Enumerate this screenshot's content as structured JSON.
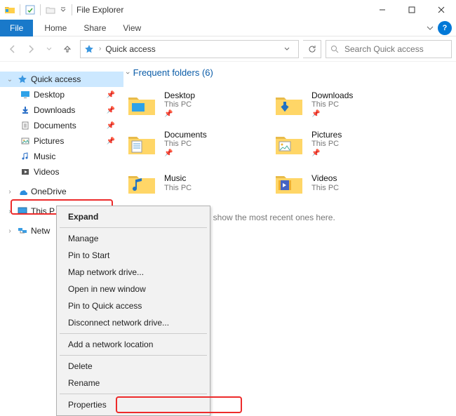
{
  "title": "File Explorer",
  "ribbon": {
    "file": "File",
    "tabs": [
      "Home",
      "Share",
      "View"
    ]
  },
  "address": {
    "text": "Quick access"
  },
  "search": {
    "placeholder": "Search Quick access"
  },
  "tree": {
    "quick_access": {
      "label": "Quick access",
      "children": [
        {
          "label": "Desktop",
          "icon": "desktop",
          "pinned": true
        },
        {
          "label": "Downloads",
          "icon": "downloads",
          "pinned": true
        },
        {
          "label": "Documents",
          "icon": "documents",
          "pinned": true
        },
        {
          "label": "Pictures",
          "icon": "pictures",
          "pinned": true
        },
        {
          "label": "Music",
          "icon": "music",
          "pinned": false
        },
        {
          "label": "Videos",
          "icon": "videos",
          "pinned": false
        }
      ]
    },
    "onedrive": "OneDrive",
    "this_pc": "This P",
    "network": "Netw"
  },
  "section": {
    "title": "Frequent folders (6)"
  },
  "folders": [
    {
      "name": "Desktop",
      "loc": "This PC"
    },
    {
      "name": "Downloads",
      "loc": "This PC"
    },
    {
      "name": "Documents",
      "loc": "This PC"
    },
    {
      "name": "Pictures",
      "loc": "This PC"
    },
    {
      "name": "Music",
      "loc": "This PC"
    },
    {
      "name": "Videos",
      "loc": "This PC"
    }
  ],
  "recent_text": "pened some files, we'll show the most recent ones here.",
  "context_menu": {
    "items": [
      {
        "label": "Expand",
        "bold": true,
        "sep_after": true
      },
      {
        "label": "Manage"
      },
      {
        "label": "Pin to Start"
      },
      {
        "label": "Map network drive..."
      },
      {
        "label": "Open in new window"
      },
      {
        "label": "Pin to Quick access"
      },
      {
        "label": "Disconnect network drive...",
        "sep_after": true
      },
      {
        "label": "Add a network location",
        "sep_after": true
      },
      {
        "label": "Delete"
      },
      {
        "label": "Rename",
        "sep_after": true
      },
      {
        "label": "Properties"
      }
    ]
  }
}
